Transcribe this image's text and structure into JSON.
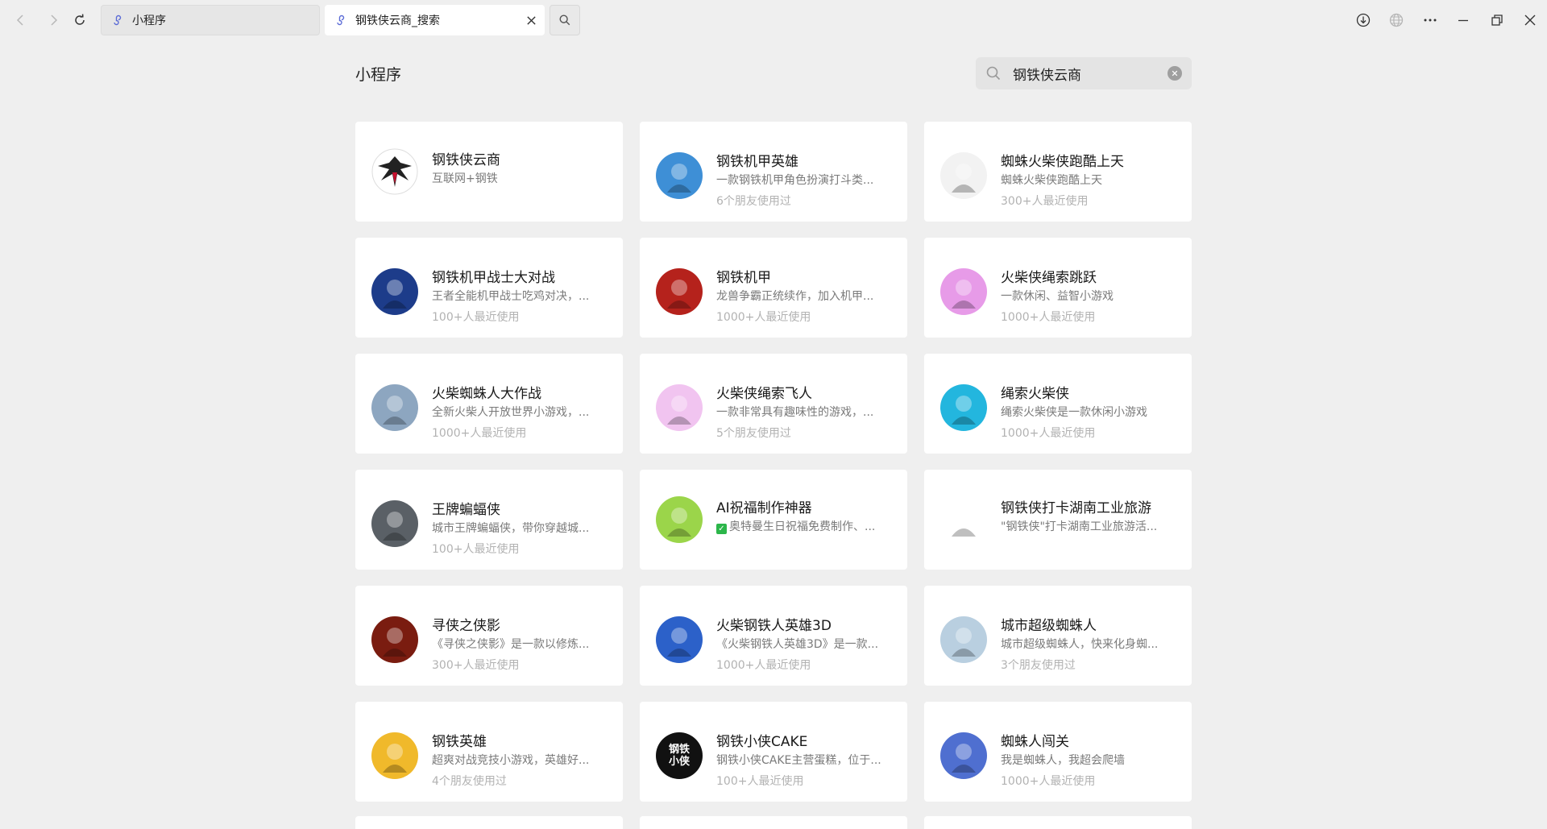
{
  "tabs": [
    {
      "label": "小程序",
      "active": false
    },
    {
      "label": "钢铁侠云商_搜索",
      "active": true
    }
  ],
  "header": {
    "title": "小程序",
    "search_value": "钢铁侠云商"
  },
  "colors": {
    "background": "#efefef",
    "card": "#ffffff",
    "tab_icon": "#5b6bd6"
  },
  "results": [
    {
      "name": "钢铁侠云商",
      "desc": "互联网+钢铁",
      "meta": "",
      "icon": "eagle-logo-icon",
      "bg": "#ffffff"
    },
    {
      "name": "钢铁机甲英雄",
      "desc": "一款钢铁机甲角色扮演打斗类...",
      "meta": "6个朋友使用过",
      "icon": "mech-robot-icon",
      "bg": "#3e8fd6"
    },
    {
      "name": "蜘蛛火柴侠跑酷上天",
      "desc": "蜘蛛火柴侠跑酷上天",
      "meta": "300+人最近使用",
      "icon": "spider-hero-icon",
      "bg": "#f2f2f2"
    },
    {
      "name": "钢铁机甲战士大对战",
      "desc": "王者全能机甲战士吃鸡对决，...",
      "meta": "100+人最近使用",
      "icon": "mech-warrior-icon",
      "bg": "#1d3c8a"
    },
    {
      "name": "钢铁机甲",
      "desc": "龙兽争霸正统续作，加入机甲...",
      "meta": "1000+人最近使用",
      "icon": "red-mech-icon",
      "bg": "#b5221c"
    },
    {
      "name": "火柴侠绳索跳跃",
      "desc": "一款休闲、益智小游戏",
      "meta": "1000+人最近使用",
      "icon": "rope-jump-icon",
      "bg": "#e79be8"
    },
    {
      "name": "火柴蜘蛛人大作战",
      "desc": "全新火柴人开放世界小游戏，...",
      "meta": "1000+人最近使用",
      "icon": "stick-spider-icon",
      "bg": "#8da6c0"
    },
    {
      "name": "火柴侠绳索飞人",
      "desc": "一款非常具有趣味性的游戏，...",
      "meta": "5个朋友使用过",
      "icon": "rope-fly-icon",
      "bg": "#f1c4f0"
    },
    {
      "name": "绳索火柴侠",
      "desc": "绳索火柴侠是一款休闲小游戏",
      "meta": "1000+人最近使用",
      "icon": "rope-stickman-icon",
      "bg": "#23b6de"
    },
    {
      "name": "王牌蝙蝠侠",
      "desc": "城市王牌蝙蝠侠，带你穿越城...",
      "meta": "100+人最近使用",
      "icon": "bat-hero-icon",
      "bg": "#5a6066"
    },
    {
      "name": "AI祝福制作神器",
      "desc": "奥特曼生日祝福免费制作、...",
      "meta": "",
      "icon": "smiley-sunglasses-icon",
      "bg": "#9bd54a",
      "check": true
    },
    {
      "name": "钢铁侠打卡湖南工业旅游",
      "desc": "\"钢铁侠\"打卡湖南工业旅游活...",
      "meta": "",
      "icon": "mascot-icon",
      "bg": "#ffffff"
    },
    {
      "name": "寻侠之侠影",
      "desc": "《寻侠之侠影》是一款以修炼...",
      "meta": "300+人最近使用",
      "icon": "xunxia-icon",
      "bg": "#7a1c10"
    },
    {
      "name": "火柴钢铁人英雄3D",
      "desc": "《火柴钢铁人英雄3D》是一款...",
      "meta": "1000+人最近使用",
      "icon": "stick-iron-icon",
      "bg": "#2c61c9"
    },
    {
      "name": "城市超级蜘蛛人",
      "desc": "城市超级蜘蛛人，快来化身蜘...",
      "meta": "3个朋友使用过",
      "icon": "city-spider-icon",
      "bg": "#b9cfe0"
    },
    {
      "name": "钢铁英雄",
      "desc": "超爽对战竞技小游戏，英雄好...",
      "meta": "4个朋友使用过",
      "icon": "pk-hero-icon",
      "bg": "#f0b92b"
    },
    {
      "name": "钢铁小侠CAKE",
      "desc": "钢铁小侠CAKE主营蛋糕，位于...",
      "meta": "100+人最近使用",
      "icon": "cake-brand-icon",
      "bg": "#111111",
      "logo_text": "钢铁\n小侠"
    },
    {
      "name": "蜘蛛人闯关",
      "desc": "我是蜘蛛人，我超会爬墙",
      "meta": "1000+人最近使用",
      "icon": "spider-pixel-icon",
      "bg": "#4f6fd0"
    }
  ]
}
